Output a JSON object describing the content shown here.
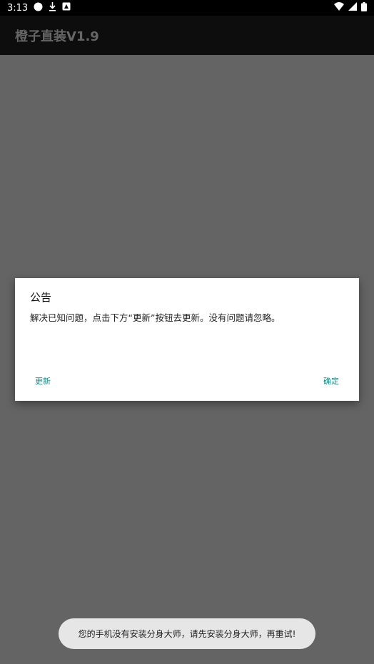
{
  "status_bar": {
    "time": "3:13",
    "left_icons": [
      "circle-icon",
      "download-icon",
      "notification-icon"
    ],
    "right_icons": [
      "wifi-icon",
      "signal-icon",
      "battery-icon"
    ]
  },
  "app_bar": {
    "title": "橙子直装V1.9"
  },
  "dialog": {
    "title": "公告",
    "message": "解决已知问题，点击下方“更新”按钮去更新。没有问题请忽略。",
    "update_label": "更新",
    "ok_label": "确定"
  },
  "toast": {
    "text": "您的手机没有安装分身大师，请先安装分身大师，再重试!"
  },
  "colors": {
    "overlay": "#646464",
    "app_bar": "#0d0d0d",
    "accent": "#1a8c86",
    "dialog_bg": "#ffffff",
    "toast_bg": "#e6e6e6"
  }
}
